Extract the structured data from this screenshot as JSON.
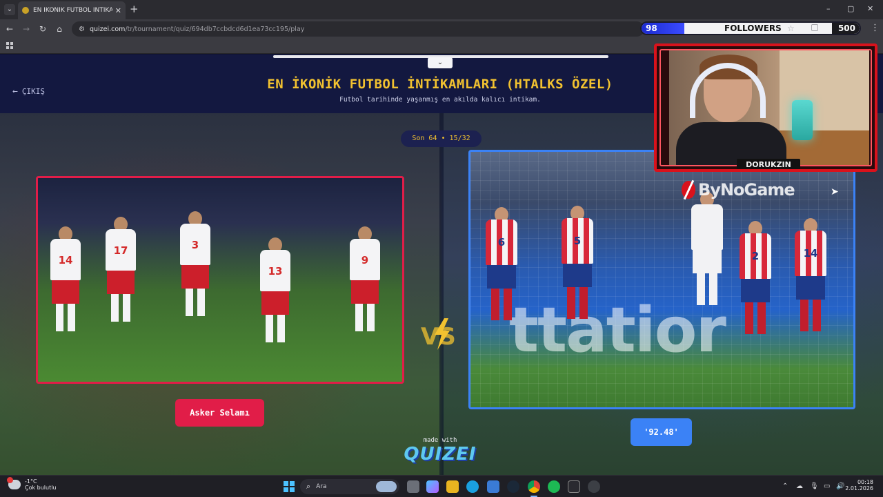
{
  "browser": {
    "tab_title": "EN İKONİK FUTBOL İNTİKAMLARI",
    "new_tab": "+",
    "url_host": "quizei.com",
    "url_path": "/tr/tournament/quiz/694db7ccbdcd6d1ea73cc195/play",
    "window_controls": [
      "–",
      "▢",
      "✕"
    ]
  },
  "stream_overlay": {
    "current_followers": "98",
    "label": "FOLLOWERS",
    "goal": "500",
    "progress_fraction": 0.196,
    "webcam_name": "DORUKZIN",
    "watermark": "ByNoGame"
  },
  "page": {
    "exit_label": "ÇIKIŞ",
    "title": "EN İKONİK FUTBOL İNTİKAMLARI (HTALKS ÖZEL)",
    "subtitle": "Futbol tarihinde yaşanmış en akılda kalıcı intikam.",
    "round": "Son 64 • 15/32",
    "left_choice": "Asker Selamı",
    "right_choice": "'92.48'",
    "left_numbers": [
      "14",
      "17",
      "3",
      "13",
      "9"
    ],
    "right_numbers": [
      "6",
      "5",
      "2",
      "14"
    ],
    "board_text": "ttatior",
    "made_with": "made with",
    "brand": "QUIZEI",
    "colors": {
      "title": "#f2c230",
      "left_accent": "#e11d48",
      "right_accent": "#3b82f6"
    }
  },
  "taskbar": {
    "temperature": "-1°C",
    "weather_desc": "Çok bulutlu",
    "search_placeholder": "Ara",
    "time": "00:18",
    "date": "2.01.2026"
  }
}
